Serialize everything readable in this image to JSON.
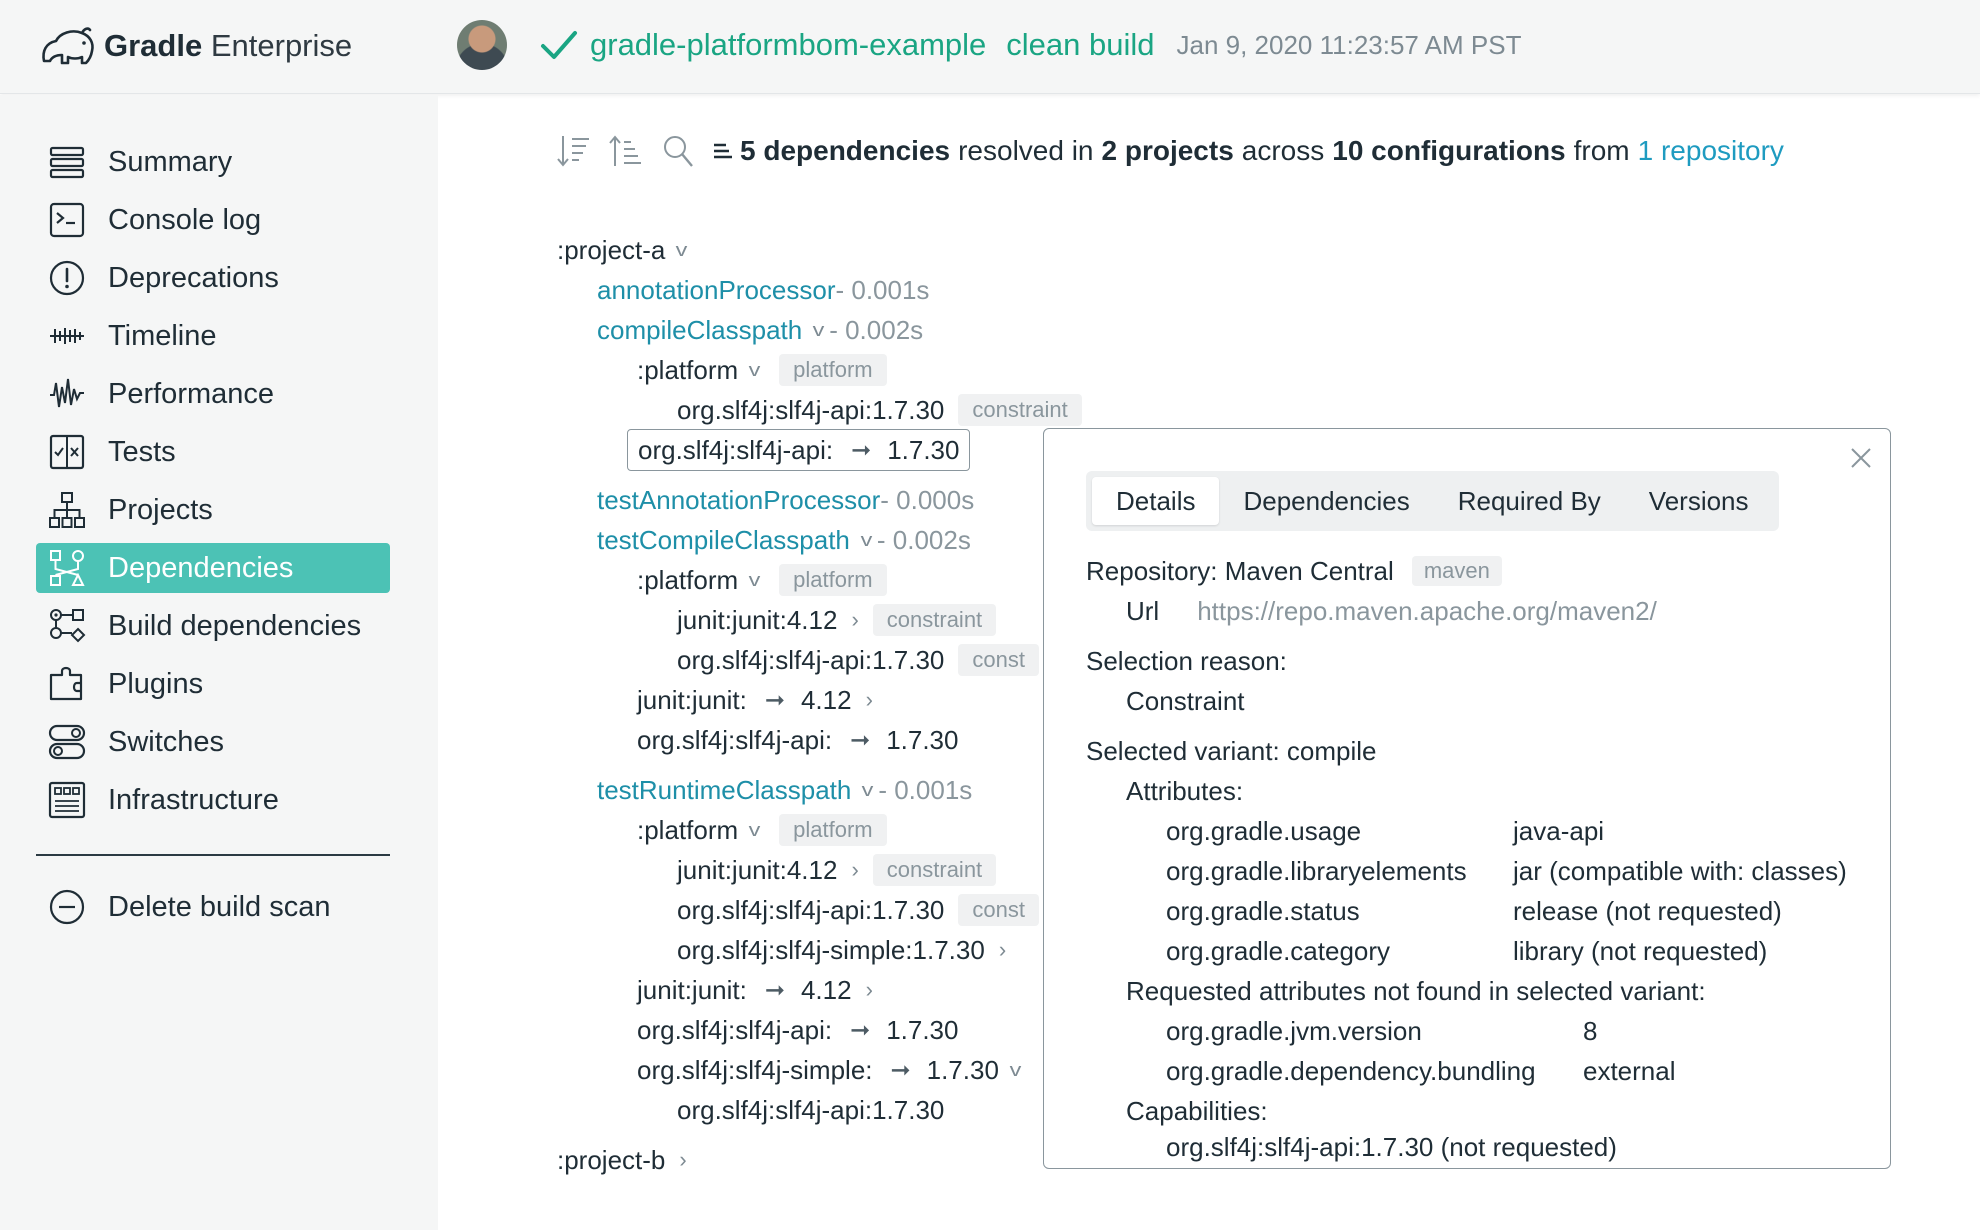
{
  "header": {
    "logo_bold": "Gradle",
    "logo_light": "Enterprise",
    "project": "gradle-platformbom-example",
    "task": "clean build",
    "timestamp": "Jan 9, 2020 11:23:57 AM PST",
    "status_color": "#1aa583"
  },
  "sidebar": {
    "items": [
      {
        "label": "Summary",
        "icon": "summary-icon"
      },
      {
        "label": "Console log",
        "icon": "console-icon"
      },
      {
        "label": "Deprecations",
        "icon": "deprecation-icon"
      },
      {
        "label": "Timeline",
        "icon": "timeline-icon"
      },
      {
        "label": "Performance",
        "icon": "performance-icon"
      },
      {
        "label": "Tests",
        "icon": "tests-icon"
      },
      {
        "label": "Projects",
        "icon": "projects-icon"
      },
      {
        "label": "Dependencies",
        "icon": "dependencies-icon",
        "active": true
      },
      {
        "label": "Build dependencies",
        "icon": "build-dependencies-icon"
      },
      {
        "label": "Plugins",
        "icon": "plugins-icon"
      },
      {
        "label": "Switches",
        "icon": "switches-icon"
      },
      {
        "label": "Infrastructure",
        "icon": "infrastructure-icon"
      }
    ],
    "delete_label": "Delete build scan",
    "active_color": "#4cc2b5"
  },
  "summary": {
    "dependencies_count": "5 dependencies",
    "resolved_in": "resolved in",
    "projects_count": "2 projects",
    "across": "across",
    "configurations_count": "10 configurations",
    "from": "from",
    "repository_link": "1 repository"
  },
  "tree": {
    "project_a": ":project-a",
    "project_b": ":project-b",
    "annotationProcessor": {
      "name": "annotationProcessor",
      "duration": "- 0.001s"
    },
    "compileClasspath": {
      "name": "compileClasspath",
      "duration": "- 0.002s"
    },
    "testAnnotationProcessor": {
      "name": "testAnnotationProcessor",
      "duration": "- 0.000s"
    },
    "testCompileClasspath": {
      "name": "testCompileClasspath",
      "duration": "- 0.002s"
    },
    "testRuntimeClasspath": {
      "name": "testRuntimeClasspath",
      "duration": "- 0.001s"
    },
    "platform": ":platform",
    "platform_tag": "platform",
    "constraint_tag": "constraint",
    "constraint_tag_truncated": "const",
    "slf4j_api_full": "org.slf4j:slf4j-api:1.7.30",
    "slf4j_api_req": "org.slf4j:slf4j-api:",
    "slf4j_version": "1.7.30",
    "junit_full": "junit:junit:4.12",
    "junit_req": "junit:junit:",
    "junit_version": "4.12",
    "slf4j_simple_full": "org.slf4j:slf4j-simple:1.7.30",
    "slf4j_simple_req": "org.slf4j:slf4j-simple:"
  },
  "details": {
    "tabs": [
      "Details",
      "Dependencies",
      "Required By",
      "Versions"
    ],
    "repository_label": "Repository: Maven Central",
    "repository_tag": "maven",
    "url_label": "Url",
    "url_value": "https://repo.maven.apache.org/maven2/",
    "selection_reason_label": "Selection reason:",
    "selection_reason_value": "Constraint",
    "selected_variant": "Selected variant: compile",
    "attributes_label": "Attributes:",
    "attributes": [
      {
        "key": "org.gradle.usage",
        "value": "java-api"
      },
      {
        "key": "org.gradle.libraryelements",
        "value": "jar (compatible with: classes)"
      },
      {
        "key": "org.gradle.status",
        "value": "release (not requested)"
      },
      {
        "key": "org.gradle.category",
        "value": "library (not requested)"
      }
    ],
    "requested_not_found_label": "Requested attributes not found in selected variant:",
    "requested_not_found": [
      {
        "key": "org.gradle.jvm.version",
        "value": "8"
      },
      {
        "key": "org.gradle.dependency.bundling",
        "value": "external"
      }
    ],
    "capabilities_label": "Capabilities:",
    "capability": "org.slf4j:slf4j-api:1.7.30 (not requested)"
  }
}
